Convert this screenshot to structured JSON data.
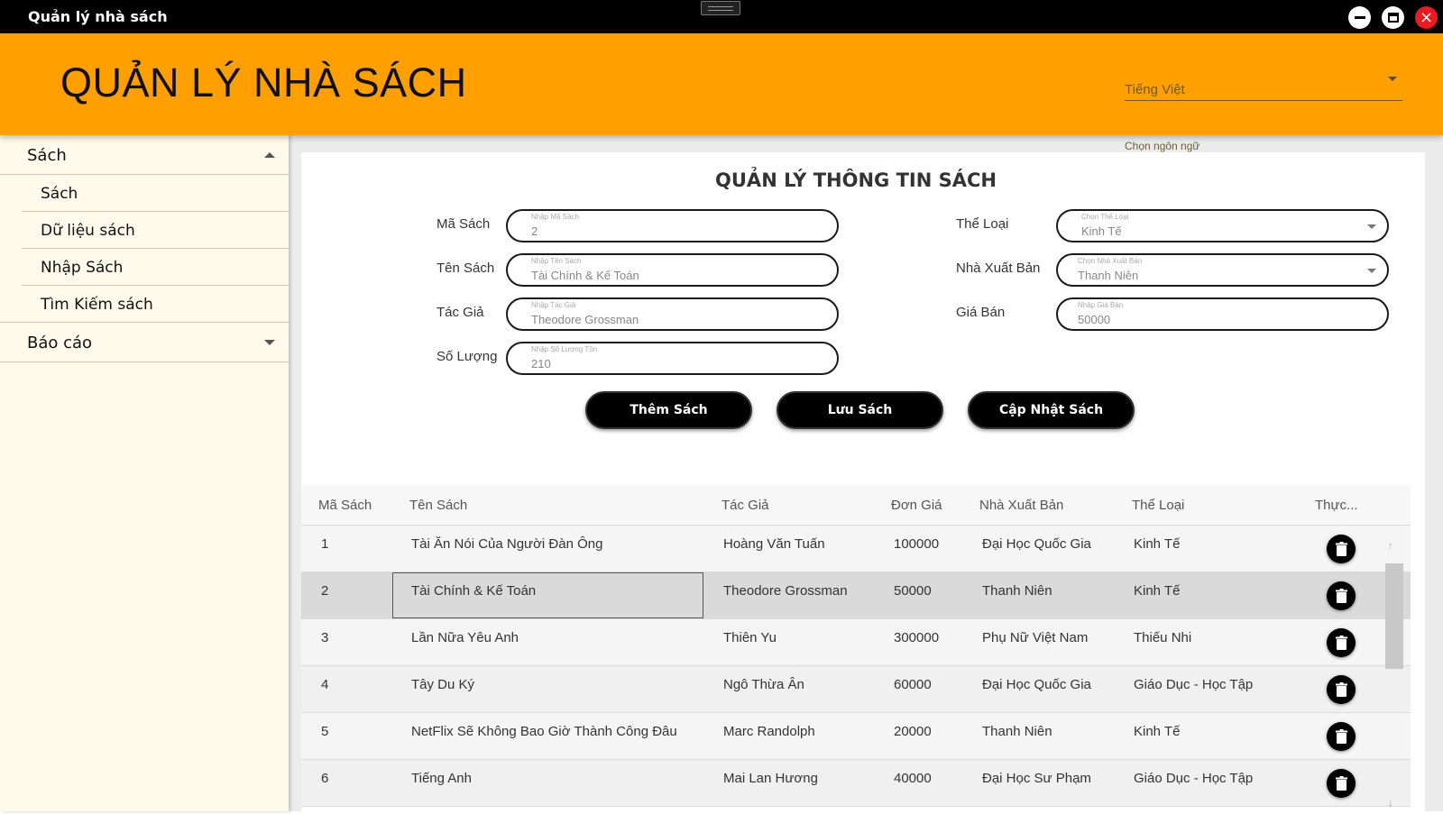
{
  "window": {
    "title": "Quản lý nhà sách"
  },
  "header": {
    "brand": "QUẢN LÝ NHÀ SÁCH",
    "language": {
      "value": "Tiếng Việt",
      "helper": "Chọn ngôn ngữ"
    }
  },
  "sidebar": {
    "groups": [
      {
        "label": "Sách",
        "expanded": true,
        "items": [
          "Sách",
          "Dữ liệu sách",
          "Nhập Sách",
          "Tìm Kiếm sách"
        ]
      },
      {
        "label": "Báo cáo",
        "expanded": false
      }
    ]
  },
  "form": {
    "title": "QUẢN LÝ THÔNG TIN SÁCH",
    "ma_sach": {
      "label": "Mã Sách",
      "placeholder": "Nhập Mã Sách",
      "value": "2"
    },
    "ten_sach": {
      "label": "Tên Sách",
      "placeholder": "Nhập Tên Sách",
      "value": "Tài Chính & Kế Toán"
    },
    "tac_gia": {
      "label": "Tác Giả",
      "placeholder": "Nhập Tác Giả",
      "value": "Theodore Grossman"
    },
    "so_luong": {
      "label": "Số Lượng",
      "placeholder": "Nhập Số Lượng Tồn",
      "value": "210"
    },
    "the_loai": {
      "label": "Thể Loại",
      "placeholder": "Chọn Thể Loại",
      "value": "Kinh Tế"
    },
    "nha_xuat_ban": {
      "label": "Nhà Xuất Bản",
      "placeholder": "Chọn Nhà Xuất Bản",
      "value": "Thanh Niên"
    },
    "gia_ban": {
      "label": "Giá Bán",
      "placeholder": "Nhập Giá Bán",
      "value": "50000"
    },
    "buttons": {
      "add": "Thêm Sách",
      "save": "Lưu Sách",
      "update": "Cập Nhật Sách"
    }
  },
  "table": {
    "columns": [
      "Mã Sách",
      "Tên Sách",
      "Tác Giả",
      "Đơn Giá",
      "Nhà Xuất Bản",
      "Thể Loại",
      "Thực..."
    ],
    "rows": [
      [
        "1",
        "Tài Ăn Nói Của Người Đàn Ông",
        "Hoàng Văn Tuấn",
        "100000",
        "Đại Học Quốc Gia",
        "Kinh Tế"
      ],
      [
        "2",
        "Tài Chính & Kế Toán",
        "Theodore Grossman",
        "50000",
        "Thanh Niên",
        "Kinh Tế"
      ],
      [
        "3",
        "Lần Nữa Yêu Anh",
        "Thiên Yu",
        "300000",
        "Phụ Nữ Việt Nam",
        "Thiếu Nhi"
      ],
      [
        "4",
        "Tây Du Ký",
        "Ngô Thừa Ân",
        "60000",
        "Đại Học Quốc Gia",
        "Giáo Dục - Học Tập"
      ],
      [
        "5",
        "NetFlix Sẽ Không Bao Giờ Thành Công Đâu",
        "Marc Randolph",
        "20000",
        "Thanh Niên",
        "Kinh Tế"
      ],
      [
        "6",
        "Tiếng Anh",
        "Mai Lan Hương",
        "40000",
        "Đại Học Sư Phạm",
        "Giáo Dục - Học Tập"
      ]
    ],
    "selected_row": 2
  },
  "icons": {
    "delete": "trash-icon",
    "minimize": "minimize-icon",
    "maximize": "maximize-icon",
    "close": "close-icon"
  },
  "colors": {
    "accent": "#ff9f00",
    "titlebar": "#000000",
    "sidebar_bg": "#fffaeb",
    "close_button": "#e81b23"
  }
}
